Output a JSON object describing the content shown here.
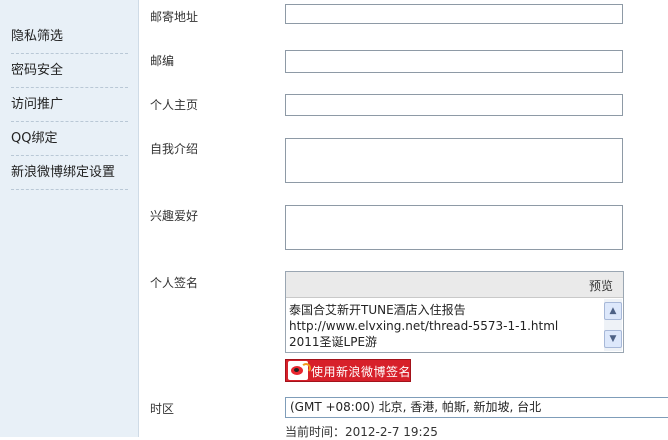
{
  "sidebar": {
    "items": [
      {
        "label": "隐私筛选"
      },
      {
        "label": "密码安全"
      },
      {
        "label": "访问推广"
      },
      {
        "label": "QQ绑定"
      },
      {
        "label": "新浪微博绑定设置"
      }
    ]
  },
  "form": {
    "address_label": "邮寄地址",
    "zipcode_label": "邮编",
    "homepage_label": "个人主页",
    "bio_label": "自我介绍",
    "hobby_label": "兴趣爱好",
    "signature": {
      "label": "个人签名",
      "preview_label": "预览",
      "lines": [
        "泰国合艾新开TUNE酒店入住报告",
        "http://www.elvxing.net/thread-5573-1-1.html",
        "2011圣诞LPE游"
      ]
    },
    "weibo_button_label": "使用新浪微博签名",
    "timezone": {
      "label": "时区",
      "selected": "(GMT +08:00) 北京, 香港, 帕斯, 新加坡, 台北"
    },
    "current_time": "当前时间：2012-2-7 19:25"
  },
  "colors": {
    "sidebar_bg": "#e8f0f7",
    "weibo_red": "#d7202a"
  }
}
